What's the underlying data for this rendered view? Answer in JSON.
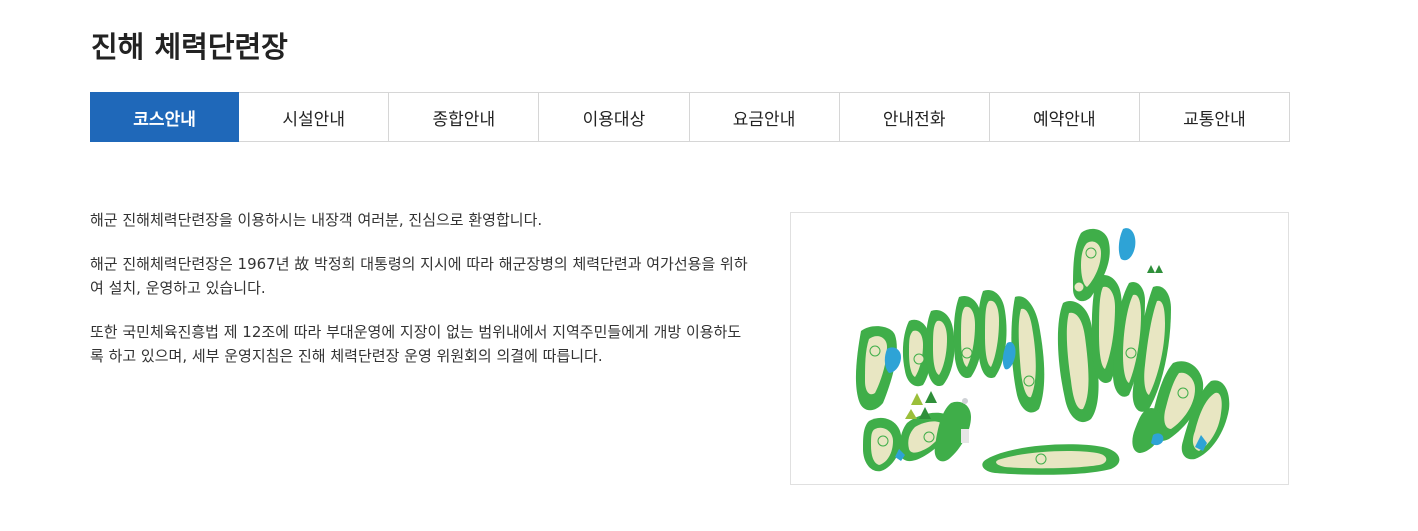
{
  "page": {
    "title": "진해 체력단련장"
  },
  "tabs": [
    {
      "label": "코스안내",
      "active": true
    },
    {
      "label": "시설안내",
      "active": false
    },
    {
      "label": "종합안내",
      "active": false
    },
    {
      "label": "이용대상",
      "active": false
    },
    {
      "label": "요금안내",
      "active": false
    },
    {
      "label": "안내전화",
      "active": false
    },
    {
      "label": "예약안내",
      "active": false
    },
    {
      "label": "교통안내",
      "active": false
    }
  ],
  "intro": {
    "paragraph_1": "해군 진해체력단련장을 이용하시는 내장객 여러분, 진심으로 환영합니다.",
    "paragraph_2": "해군 진해체력단련장은 1967년 故 박정희 대통령의 지시에 따라 해군장병의 체력단련과 여가선용을 위하여 설치, 운영하고 있습니다.",
    "paragraph_3": "또한 국민체육진흥법 제 12조에 따라 부대운영에 지장이 없는 범위내에서 지역주민들에게 개방 이용하도록 하고 있으며, 세부 운영지침은 진해 체력단련장 운영 위원회의 의결에 따릅니다."
  },
  "colors": {
    "accent": "#1f68b9",
    "fairway": "#3fae49",
    "green": "#e8e6c2",
    "water": "#2ea3d6",
    "tree": "#2f8f3a",
    "bunker": "#f2ecd0"
  },
  "map": {
    "icon": "golf-course-map"
  }
}
